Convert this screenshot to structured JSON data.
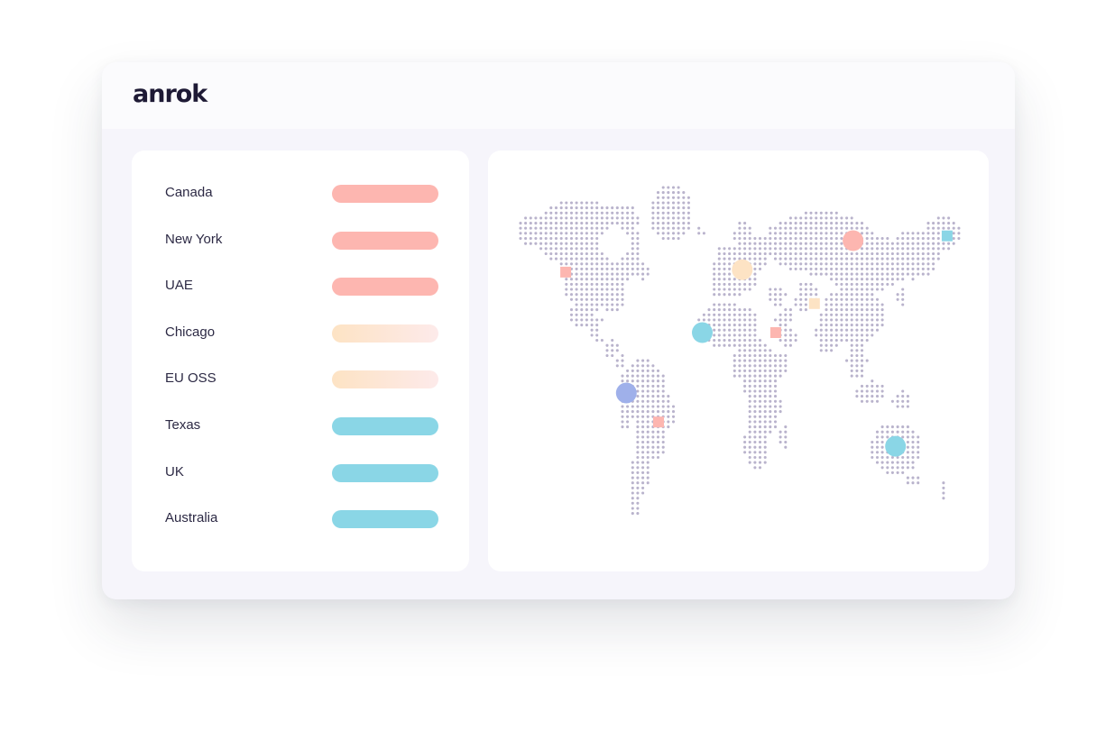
{
  "app": {
    "logo_text": "anrok"
  },
  "jurisdictions": [
    {
      "label": "Canada",
      "status": "red"
    },
    {
      "label": "New York",
      "status": "red"
    },
    {
      "label": "UAE",
      "status": "red"
    },
    {
      "label": "Chicago",
      "status": "amber"
    },
    {
      "label": "EU OSS",
      "status": "amber"
    },
    {
      "label": "Texas",
      "status": "teal"
    },
    {
      "label": "UK",
      "status": "teal"
    },
    {
      "label": "Australia",
      "status": "teal"
    }
  ],
  "status_colors": {
    "red": "#fdb6b0",
    "amber": "#fde3c4",
    "amber_fade": "#fdeaea",
    "teal": "#8ad6e6",
    "blue": "#9fb0ea",
    "map_dot": "#b9b3cc"
  },
  "map": {
    "markers": [
      {
        "shape": "circle",
        "color": "red",
        "lon": 100,
        "lat": 61
      },
      {
        "shape": "square",
        "color": "teal",
        "lon": 173,
        "lat": 63
      },
      {
        "shape": "square",
        "color": "red",
        "lon": -123,
        "lat": 48
      },
      {
        "shape": "circle",
        "color": "amber",
        "lon": 14,
        "lat": 49
      },
      {
        "shape": "square",
        "color": "amber",
        "lon": 70,
        "lat": 35
      },
      {
        "shape": "circle",
        "color": "teal",
        "lon": -17,
        "lat": 23
      },
      {
        "shape": "square",
        "color": "red",
        "lon": 40,
        "lat": 23
      },
      {
        "shape": "circle",
        "color": "blue",
        "lon": -76,
        "lat": -2
      },
      {
        "shape": "square",
        "color": "red",
        "lon": -51,
        "lat": -14
      },
      {
        "shape": "circle",
        "color": "teal",
        "lon": 133,
        "lat": -24
      }
    ]
  }
}
